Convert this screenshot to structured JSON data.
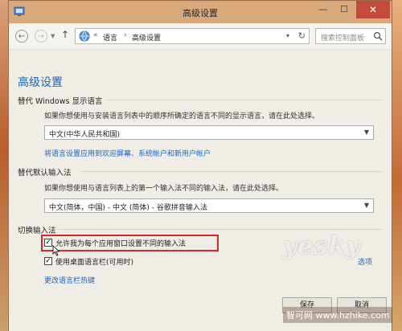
{
  "window": {
    "title": "高级设置"
  },
  "titlebar_buttons": {
    "minimize": "—",
    "maximize": "☐",
    "close": "✕"
  },
  "nav": {
    "breadcrumb_sep": "«",
    "breadcrumb": [
      "语言",
      "高级设置"
    ],
    "breadcrumb_arrow": "›",
    "search_placeholder": "搜索控制面板"
  },
  "page": {
    "heading": "高级设置"
  },
  "display_language": {
    "section_title": "替代 Windows 显示语言",
    "description": "如果你想使用与安装语言列表中的顺序所确定的语言不同的显示语言，请在此处选择。",
    "selected": "中文(中华人民共和国)",
    "link": "将语言设置应用到欢迎屏幕、系统帐户和新用户帐户"
  },
  "input_method": {
    "section_title": "替代默认输入法",
    "description": "如果你想使用与语言列表上的第一个输入法不同的输入法，请在此处选择。",
    "selected": "中文(简体，中国) - 中文 (简体) - 谷歌拼音输入法"
  },
  "switch_input": {
    "section_title": "切换输入法",
    "checkbox1_label": "允许我为每个应用窗口设置不同的输入法",
    "checkbox1_checked": true,
    "checkbox2_label": "使用桌面语言栏(可用时)",
    "checkbox2_checked": true,
    "options_link": "选项",
    "hotkeys_link": "更改语言栏热键"
  },
  "footer": {
    "save": "保存",
    "cancel": "取消"
  },
  "watermark": {
    "brand": "yesky",
    "site": "智可网 www.hzhike.com"
  },
  "colors": {
    "accent": "#1e64b8",
    "link": "#1a66c4",
    "highlight": "#d7262d"
  }
}
